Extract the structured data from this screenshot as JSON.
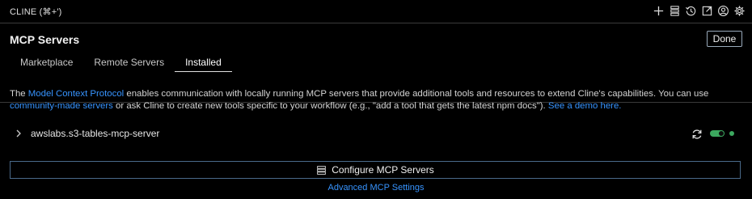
{
  "topbar": {
    "title": "CLINE (⌘+')",
    "icons": [
      "plus-icon",
      "server-icon",
      "history-icon",
      "external-link-icon",
      "account-icon",
      "gear-icon"
    ]
  },
  "header": {
    "title": "MCP Servers",
    "done_label": "Done",
    "tabs": [
      {
        "label": "Marketplace",
        "active": false
      },
      {
        "label": "Remote Servers",
        "active": false
      },
      {
        "label": "Installed",
        "active": true
      }
    ]
  },
  "description": {
    "part1": "The ",
    "link1": "Model Context Protocol",
    "part2": " enables communication with locally running MCP servers that provide additional tools and resources to extend Cline's capabilities. You can use ",
    "link2": "community-made servers",
    "part3": " or ask Cline to create new tools specific to your workflow (e.g., \"add a tool that gets the latest npm docs\"). ",
    "link3": "See a demo here."
  },
  "servers": [
    {
      "name": "awslabs.s3-tables-mcp-server",
      "enabled": true,
      "status_color": "#3ca85f"
    }
  ],
  "configure_label": "Configure MCP Servers",
  "advanced_label": "Advanced MCP Settings",
  "colors": {
    "accent": "#3794ff",
    "success": "#3ca85f",
    "background": "#000000"
  }
}
